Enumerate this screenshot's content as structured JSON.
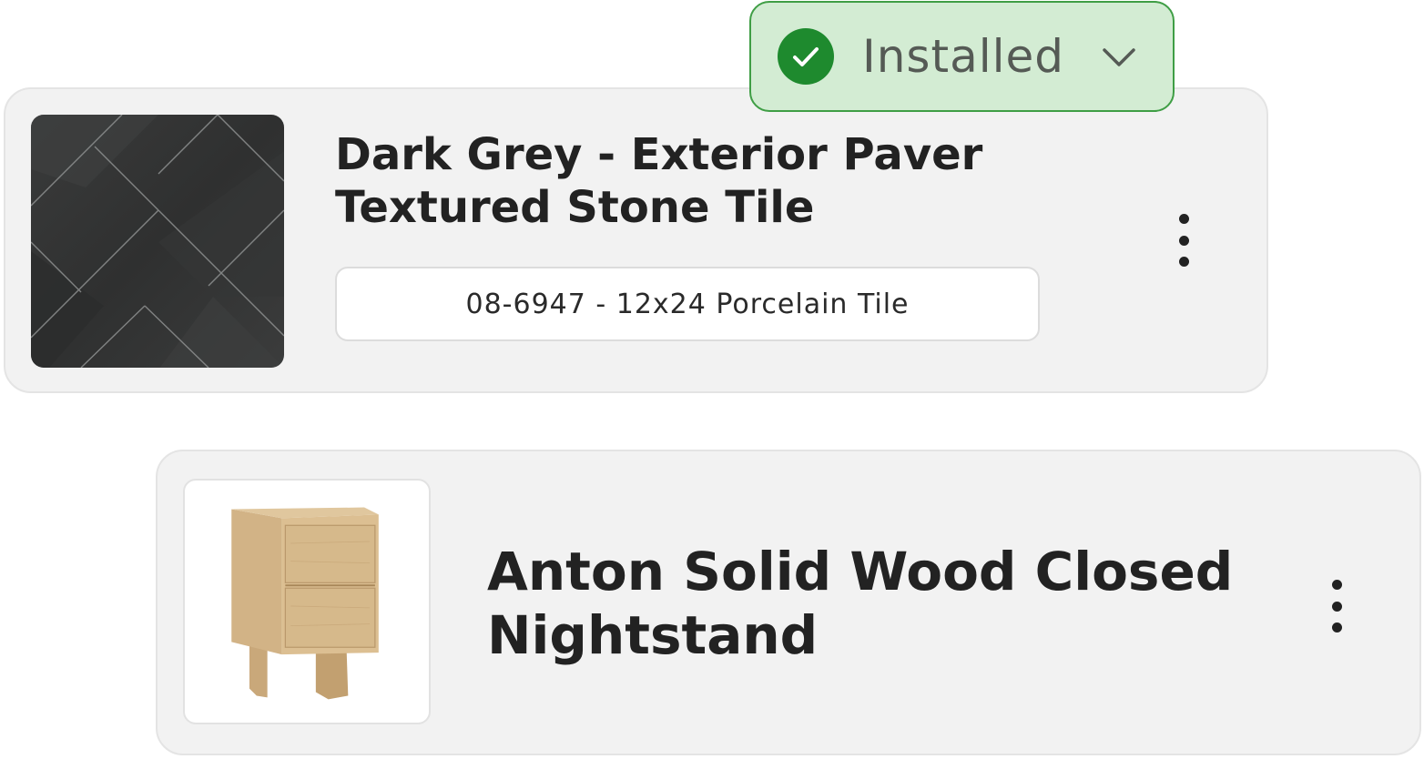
{
  "status": {
    "label": "Installed",
    "accent_color": "#1e8a2e",
    "background_color": "#d3ecd3",
    "icons": [
      "check-circle-icon",
      "chevron-down-icon"
    ]
  },
  "items": [
    {
      "title_line1": "Dark Grey - Exterior Paver",
      "title_line2": "Textured Stone Tile",
      "sku": "08-6947 - 12x24 Porcelain Tile",
      "menu_icon": "more-vertical-icon"
    },
    {
      "title_line1": "Anton Solid Wood Closed",
      "title_line2": "Nightstand",
      "menu_icon": "more-vertical-icon"
    }
  ]
}
